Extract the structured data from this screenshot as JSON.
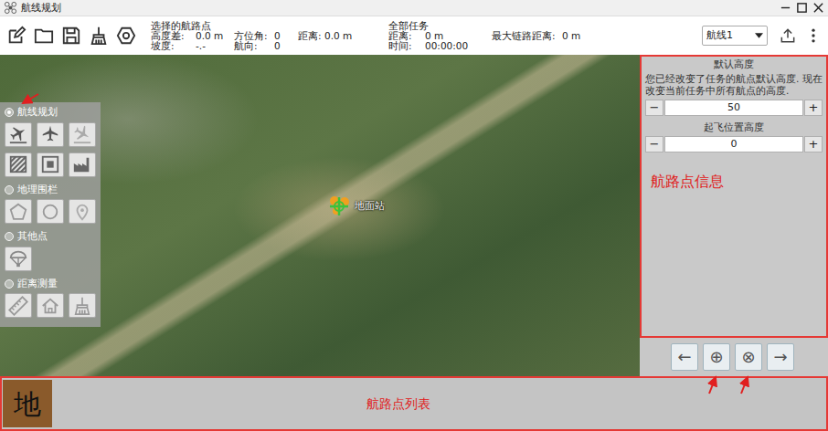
{
  "window": {
    "title": "航线规划"
  },
  "selected_waypoint": {
    "title": "选择的航路点",
    "rows": [
      [
        {
          "label": "高度差:",
          "value": "0.0 m"
        },
        {
          "label": "方位角:",
          "value": "0"
        },
        {
          "label": "距离:",
          "value": "0.0 m"
        }
      ],
      [
        {
          "label": "坡度:",
          "value": "-.-"
        },
        {
          "label": "航向:",
          "value": "0"
        }
      ]
    ]
  },
  "mission": {
    "title": "全部任务",
    "rows": [
      [
        {
          "label": "距离:",
          "value": "0 m"
        },
        {
          "label": "最大链路距离:",
          "value": "0 m"
        }
      ],
      [
        {
          "label": "时间:",
          "value": "00:00:00"
        }
      ]
    ]
  },
  "route_select": {
    "value": "航线1"
  },
  "tool_panel": {
    "sections": [
      {
        "title": "航线规划",
        "selected": true
      },
      {
        "title": "地理围栏",
        "selected": false
      },
      {
        "title": "其他点",
        "selected": false
      },
      {
        "title": "距离测量",
        "selected": false
      }
    ]
  },
  "map": {
    "home_label": "地面站"
  },
  "waypoint_info": {
    "title": "默认高度",
    "message": "您已经改变了任务的航点默认高度. 现在改变当前任务中所有航点的高度.",
    "default_altitude": {
      "minus": "−",
      "value": "50",
      "plus": "+"
    },
    "takeoff_title": "起飞位置高度",
    "takeoff_altitude": {
      "minus": "−",
      "value": "0",
      "plus": "+"
    },
    "annotation": "航路点信息"
  },
  "nav_buttons": [
    "←",
    "⊕",
    "⊗",
    "→"
  ],
  "waypoint_list": {
    "items": [
      {
        "label": "地"
      }
    ],
    "annotation": "航路点列表"
  }
}
